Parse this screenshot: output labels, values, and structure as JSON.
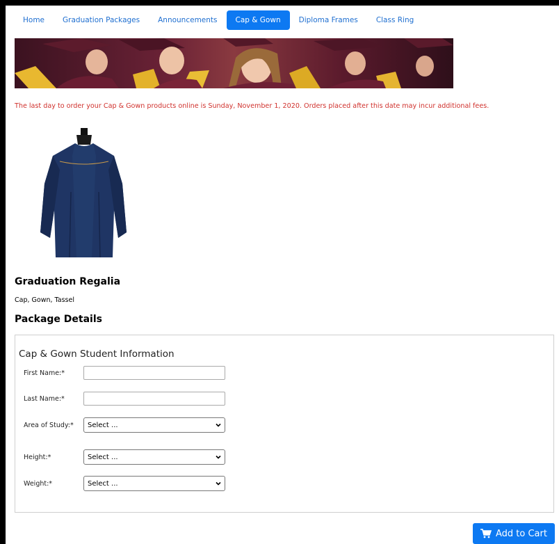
{
  "nav": {
    "items": [
      {
        "label": "Home",
        "active": false
      },
      {
        "label": "Graduation Packages",
        "active": false
      },
      {
        "label": "Announcements",
        "active": false
      },
      {
        "label": "Cap & Gown",
        "active": true
      },
      {
        "label": "Diploma Frames",
        "active": false
      },
      {
        "label": "Class Ring",
        "active": false
      }
    ]
  },
  "notice": "The last day to order your Cap & Gown products online is Sunday, November 1, 2020. Orders placed after this date may incur additional fees.",
  "product": {
    "title": "Graduation Regalia",
    "description": "Cap, Gown, Tassel"
  },
  "package_details_title": "Package Details",
  "form": {
    "legend": "Cap & Gown Student Information",
    "first_name": {
      "label": "First Name:*",
      "value": ""
    },
    "last_name": {
      "label": "Last Name:*",
      "value": ""
    },
    "area_of_study": {
      "label": "Area of Study:*",
      "selected": "Select ..."
    },
    "height": {
      "label": "Height:*",
      "selected": "Select ..."
    },
    "weight": {
      "label": "Weight:*",
      "selected": "Select ..."
    }
  },
  "cart": {
    "label": "Add to Cart",
    "icon": "cart-icon"
  },
  "colors": {
    "accent": "#0d79f2",
    "notice": "#d0312d",
    "gown": "#1f3564"
  }
}
